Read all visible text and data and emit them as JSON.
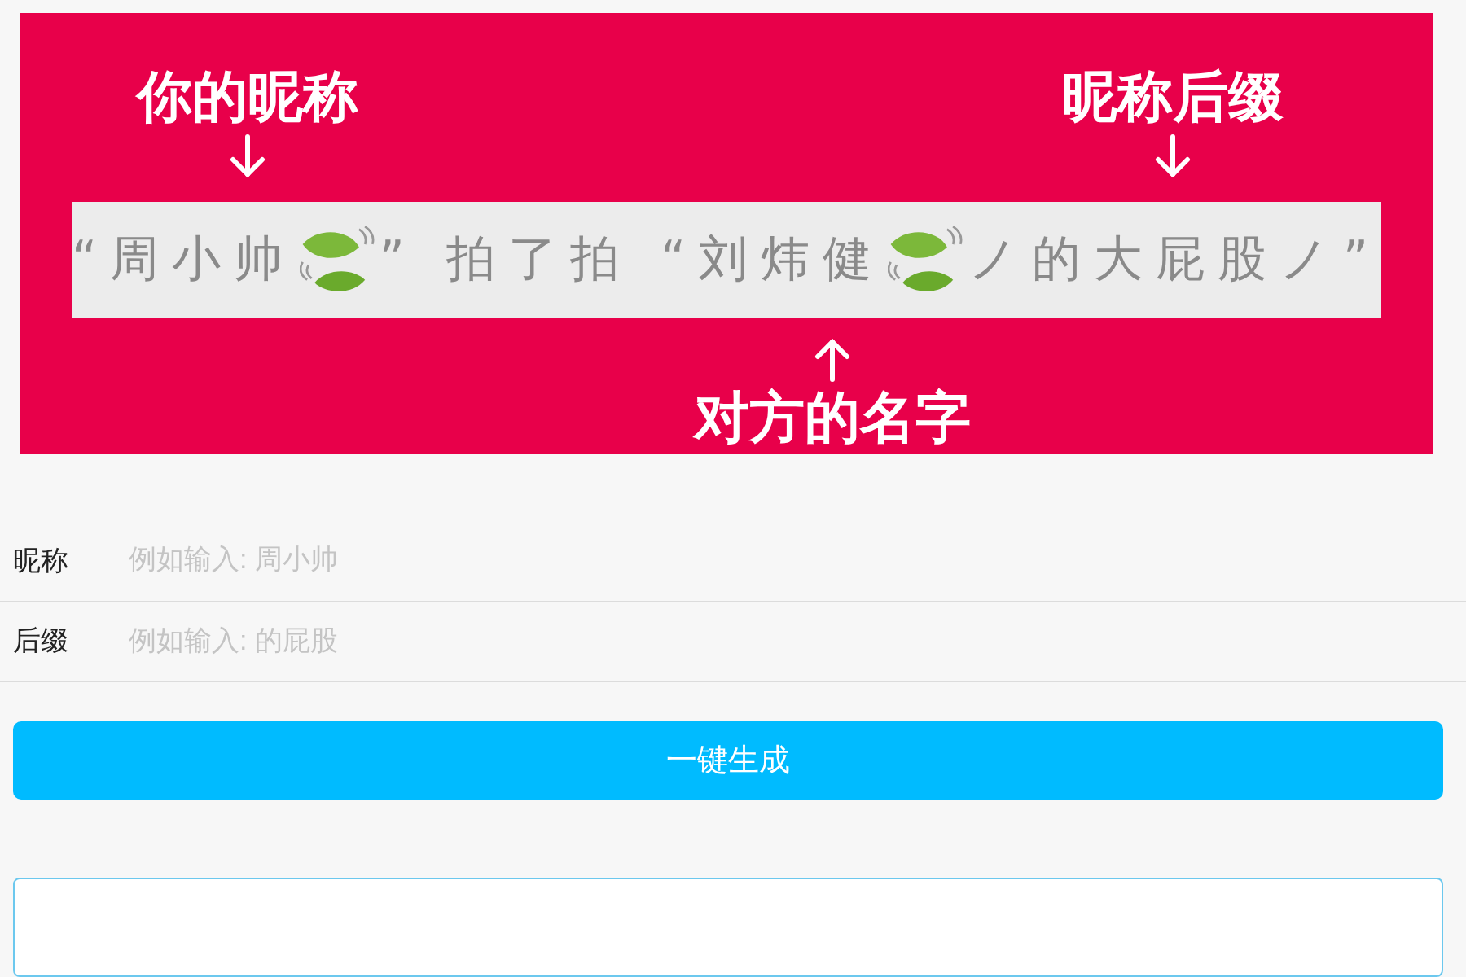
{
  "banner": {
    "top_callouts": [
      "你的昵称",
      "昵称后缀"
    ],
    "bottom_callouts": [
      "对方的名字"
    ],
    "strip": [
      {
        "kind": "text",
        "text": "“周小帅"
      },
      {
        "kind": "leaf"
      },
      {
        "kind": "text",
        "text": "” 拍了拍 “刘炜健"
      },
      {
        "kind": "leaf"
      },
      {
        "kind": "text",
        "text": "ノ的大屁股ノ”"
      }
    ]
  },
  "fields": [
    {
      "label": "昵称",
      "placeholder": "例如输入: 周小帅"
    },
    {
      "label": "后缀",
      "placeholder": "例如输入: 的屁股"
    }
  ],
  "generate_button": "一键生成",
  "output": {
    "kind": "textarea"
  }
}
